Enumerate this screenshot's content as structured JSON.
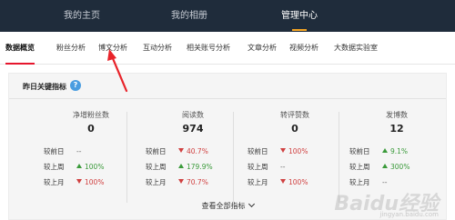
{
  "topnav": {
    "items": [
      {
        "label": "我的主页",
        "active": false
      },
      {
        "label": "我的相册",
        "active": false
      },
      {
        "label": "管理中心",
        "active": true
      }
    ]
  },
  "subnav": {
    "items": [
      {
        "label": "数据概览",
        "active": true
      },
      {
        "label": "粉丝分析",
        "active": false
      },
      {
        "label": "博文分析",
        "active": false
      },
      {
        "label": "互动分析",
        "active": false
      },
      {
        "label": "相关账号分析",
        "active": false
      },
      {
        "label": "文章分析",
        "active": false
      },
      {
        "label": "视频分析",
        "active": false
      },
      {
        "label": "大数据实验室",
        "active": false
      }
    ]
  },
  "card": {
    "title": "昨日关键指标",
    "help_icon": "?",
    "view_all": "查看全部指标",
    "columns": [
      {
        "title": "净增粉丝数",
        "value": "0",
        "rows": [
          {
            "label": "较前日",
            "trend": "flat",
            "value": "--"
          },
          {
            "label": "较上周",
            "trend": "up",
            "value": "100%"
          },
          {
            "label": "较上月",
            "trend": "down",
            "value": "100%"
          }
        ]
      },
      {
        "title": "阅读数",
        "value": "974",
        "rows": [
          {
            "label": "较前日",
            "trend": "down",
            "value": "40.7%"
          },
          {
            "label": "较上周",
            "trend": "up",
            "value": "179.9%"
          },
          {
            "label": "较上月",
            "trend": "down",
            "value": "70.7%"
          }
        ]
      },
      {
        "title": "转评赞数",
        "value": "0",
        "rows": [
          {
            "label": "较前日",
            "trend": "down",
            "value": "100%"
          },
          {
            "label": "较上周",
            "trend": "flat",
            "value": "--"
          },
          {
            "label": "较上月",
            "trend": "down",
            "value": "100%"
          }
        ]
      },
      {
        "title": "发博数",
        "value": "12",
        "rows": [
          {
            "label": "较前日",
            "trend": "up",
            "value": "9.1%"
          },
          {
            "label": "较上周",
            "trend": "up",
            "value": "300%"
          },
          {
            "label": "较上月",
            "trend": "flat",
            "value": "--"
          }
        ]
      }
    ]
  },
  "watermark": {
    "text": "Baidu经验",
    "sub": "jingyan.baidu.com"
  },
  "colors": {
    "topnav_bg": "#1f2c3b",
    "accent_red": "#e6162d",
    "up_green": "#3a9a3a",
    "down_red": "#d04040",
    "annotation_red": "#e8232a"
  }
}
